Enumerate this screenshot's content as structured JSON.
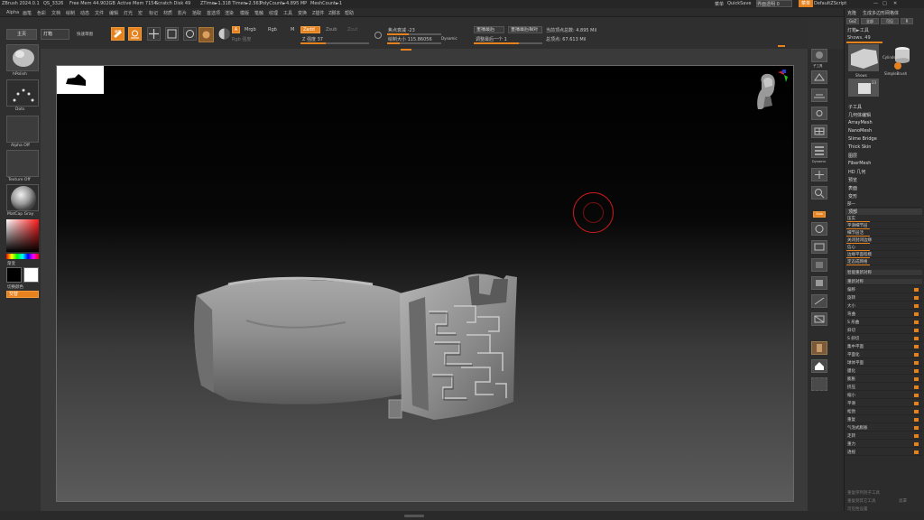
{
  "titlebar": {
    "app": "ZBrush 2024.0.1",
    "project": "QS_3326",
    "free_mem": "Free Mem 44.902GB",
    "active_mem": "Active Mem 7154",
    "scratch_disk": "Scratch Disk 49",
    "timer": "ZTime►1.318 Timer►2.563",
    "polycount": "PolyCount►4.895 MP",
    "meshcount": "MeshCount►1",
    "menus_label": "菜单",
    "quicksave": "QuickSave",
    "transparency": "界面透明 0",
    "menu_btn": "菜单",
    "defaultzscript": "DefaultZScript"
  },
  "menubar": [
    "Alpha",
    "画笔",
    "色彩",
    "文档",
    "绘制",
    "动态",
    "文件",
    "编辑",
    "灯光",
    "宏",
    "标记",
    "材质",
    "影片",
    "拾取",
    "首选项",
    "渲染",
    "模版",
    "笔触",
    "纹理",
    "工具",
    "变换",
    "Z插件",
    "Z脚本",
    "帮助"
  ],
  "left": {
    "lightbox": "主页",
    "lightbox2": "灯箱",
    "brush_name": "hPolish",
    "stroke_name": "Dots",
    "alpha_name": "Alpha Off",
    "texture_name": "Texture Off",
    "material_name": "MatCap Gray",
    "gradient_label": "渐变",
    "switch_color": "切换颜色",
    "alternate": "交替"
  },
  "toolbar": {
    "quick_sketch": "快速草图",
    "edit": "编辑",
    "draw": "绘制",
    "move": "移动",
    "scale": "缩放",
    "rotate": "旋转",
    "a_btn": "A",
    "mrgb": "Mrgb",
    "rgb": "Rgb",
    "m": "M",
    "zadd": "Zadd",
    "zsub": "Zsub",
    "zcut": "Zcut",
    "rgb_intensity": "Rgb 强度",
    "z_intensity": "Z 强度 37",
    "focal_shift": "焦点衰减 -23",
    "draw_size": "绘制大小 115.86056",
    "dynamic": "Dynamic",
    "replay_last": "重播最后",
    "replay_last_rel": "重播最后相对",
    "adjust_last": "调整最后一个 1",
    "active_points": "当前顶点总数: 4.895 Mil",
    "total_points": "总顶点: 67.613 Mil"
  },
  "rightshelf": [
    "子工具",
    "透视",
    "地面",
    "移动",
    "缩放",
    "局部",
    "网格",
    "对称",
    "Dynamic",
    "动态",
    "平移",
    "缩放",
    "旋转",
    "透明",
    "独显",
    "Line Fill",
    "多边形",
    "透明",
    "环境",
    "实例"
  ],
  "rightpanel": {
    "tabs": [
      "克隆",
      "生成多边形网格体"
    ],
    "goz": "GoZ",
    "all": "全部",
    "visible": "可见",
    "r": "R",
    "lightbox_tool": "灯箱►工具",
    "shows": "Shows. 49",
    "thumb_count": "23",
    "thumb_names": [
      "Shows",
      "Cylinder3D",
      "SimpleBrush"
    ],
    "subtool_items": [
      "子工具",
      "几何体编辑",
      "ArrayMesh",
      "NanoMesh",
      "Slime Bridge",
      "Thick Skin",
      "图层",
      "FiberMesh",
      "HD 几何",
      "预览",
      "表面",
      "变形"
    ],
    "deform_header": "变形",
    "deform_items": [
      "部一",
      "顶部",
      "压实",
      "平滑细节层",
      "细节层活",
      "关闭封闭边缘",
      "信心",
      "边缘平面程模",
      "定态成网格",
      "智能重新对称",
      "重新对称",
      "偏移",
      "旋转",
      "大小",
      "弯曲",
      "S 形曲",
      "斜切",
      "S 斜切",
      "集中平面",
      "平面化",
      "球体平面",
      "膜化",
      "膨胀",
      "挤压",
      "缩小",
      "平滑",
      "松弛",
      "重复",
      "气泡式膨胀",
      "走转",
      "重力",
      "透视"
    ],
    "bottom_items": [
      "重复序列到子工具",
      "重复到其它工具",
      "遮罩",
      "可见性设置"
    ]
  }
}
